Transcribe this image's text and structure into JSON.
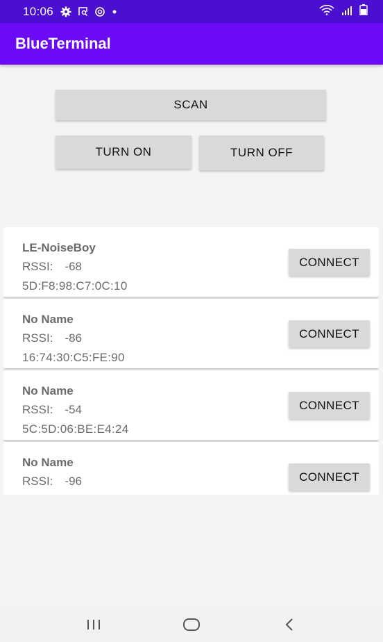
{
  "status_bar": {
    "time": "10:06",
    "left_icons": [
      "gear-icon",
      "screenshot-icon",
      "sync-icon",
      "dot-icon"
    ],
    "right_icons": [
      "wifi-icon",
      "signal-icon",
      "battery-icon"
    ]
  },
  "app_bar": {
    "title": "BlueTerminal"
  },
  "controls": {
    "scan_label": "SCAN",
    "turn_on_label": "TURN ON",
    "turn_off_label": "TURN OFF"
  },
  "devices": [
    {
      "name": "LE-NoiseBoy",
      "rssi_label": "RSSI:",
      "rssi": "-68",
      "address": "5D:F8:98:C7:0C:10",
      "connect_label": "CONNECT"
    },
    {
      "name": "No Name",
      "rssi_label": "RSSI:",
      "rssi": "-86",
      "address": "16:74:30:C5:FE:90",
      "connect_label": "CONNECT"
    },
    {
      "name": "No Name",
      "rssi_label": "RSSI:",
      "rssi": "-54",
      "address": "5C:5D:06:BE:E4:24",
      "connect_label": "CONNECT"
    },
    {
      "name": "No Name",
      "rssi_label": "RSSI:",
      "rssi": "-96",
      "address": "",
      "connect_label": "CONNECT"
    }
  ],
  "nav_bar": {
    "icons": [
      "recent-apps-icon",
      "home-icon",
      "back-icon"
    ]
  },
  "colors": {
    "status_bar": "#4a0fd0",
    "app_bar": "#6b0af5",
    "button_bg": "#d8d9d9",
    "background": "#f4f4f4"
  }
}
